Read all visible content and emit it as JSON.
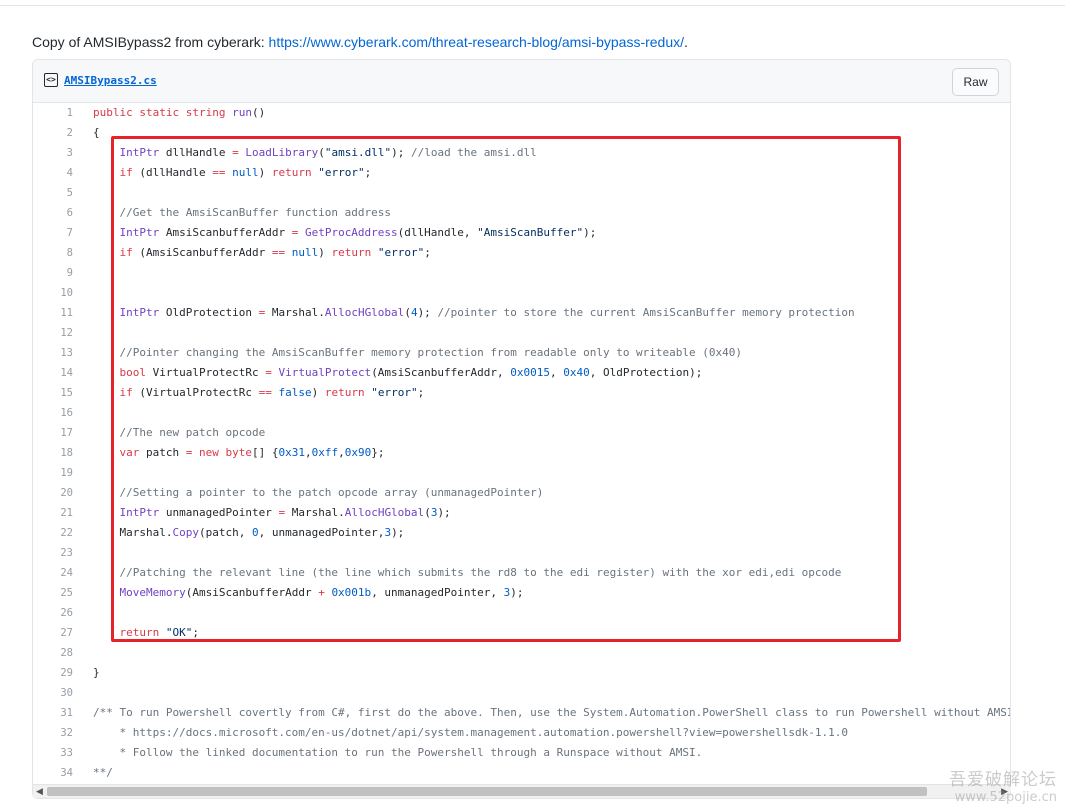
{
  "intro": {
    "prefix": "Copy of AMSIBypass2 from cyberark: ",
    "link": "https://www.cyberark.com/threat-research-blog/amsi-bypass-redux/",
    "suffix": "."
  },
  "file": {
    "name": "AMSIBypass2.cs",
    "icon": "code-file-icon",
    "raw_label": "Raw"
  },
  "code_lines": [
    {
      "n": "1"
    },
    {
      "n": "2"
    },
    {
      "n": "3"
    },
    {
      "n": "4"
    },
    {
      "n": "5"
    },
    {
      "n": "6"
    },
    {
      "n": "7"
    },
    {
      "n": "8"
    },
    {
      "n": "9"
    },
    {
      "n": "10"
    },
    {
      "n": "11"
    },
    {
      "n": "12"
    },
    {
      "n": "13"
    },
    {
      "n": "14"
    },
    {
      "n": "15"
    },
    {
      "n": "16"
    },
    {
      "n": "17"
    },
    {
      "n": "18"
    },
    {
      "n": "19"
    },
    {
      "n": "20"
    },
    {
      "n": "21"
    },
    {
      "n": "22"
    },
    {
      "n": "23"
    },
    {
      "n": "24"
    },
    {
      "n": "25"
    },
    {
      "n": "26"
    },
    {
      "n": "27"
    },
    {
      "n": "28"
    },
    {
      "n": "29"
    },
    {
      "n": "30"
    },
    {
      "n": "31"
    },
    {
      "n": "32"
    },
    {
      "n": "33"
    },
    {
      "n": "34"
    }
  ],
  "colors": {
    "highlight_box": "#e4242a",
    "link": "#0366d6",
    "keyword": "#d73a49",
    "type": "#6f42c1",
    "comment": "#6a737d",
    "number": "#005cc5"
  },
  "watermark": {
    "line1": "吾爱破解论坛",
    "line2": "www.52pojie.cn"
  }
}
